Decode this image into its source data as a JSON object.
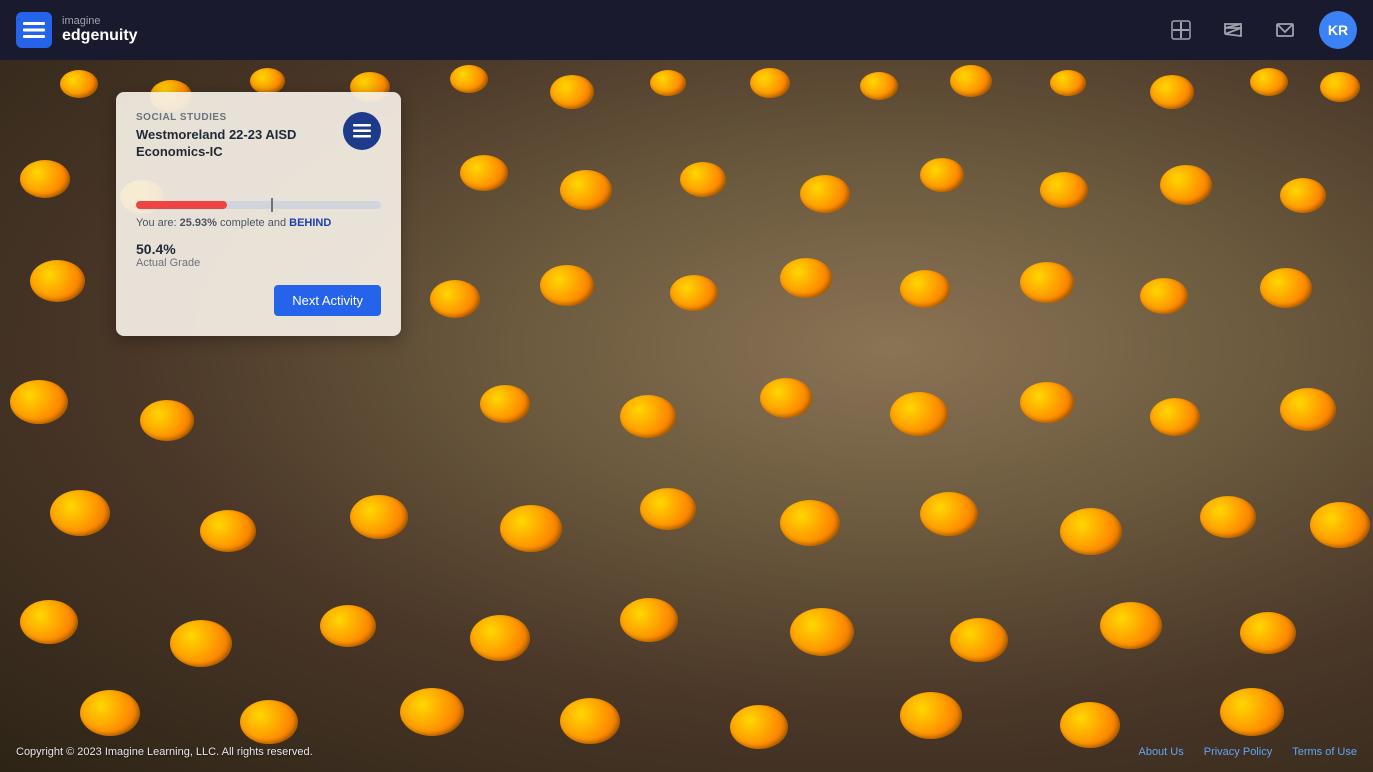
{
  "app": {
    "brand_imagine": "imagine",
    "brand_edgenuity": "edgenuity",
    "logo_icon": "≡"
  },
  "navbar": {
    "add_icon": "+",
    "announcement_icon": "📣",
    "mail_icon": "✉",
    "avatar_initials": "KR"
  },
  "course_card": {
    "subject": "SOCIAL STUDIES",
    "course_name": "Westmoreland 22-23 AISD",
    "course_sub": "Economics-IC",
    "card_icon": "≡",
    "progress_complete": "25.93%",
    "progress_text_1": "You are:",
    "progress_text_2": "complete and",
    "progress_status": "BEHIND",
    "grade_value": "50.4%",
    "grade_label": "Actual Grade",
    "next_activity_label": "Next Activity"
  },
  "footer": {
    "copyright": "Copyright © 2023 Imagine Learning, LLC. All rights reserved.",
    "link_about": "About Us",
    "link_privacy": "Privacy Policy",
    "link_terms": "Terms of Use"
  }
}
